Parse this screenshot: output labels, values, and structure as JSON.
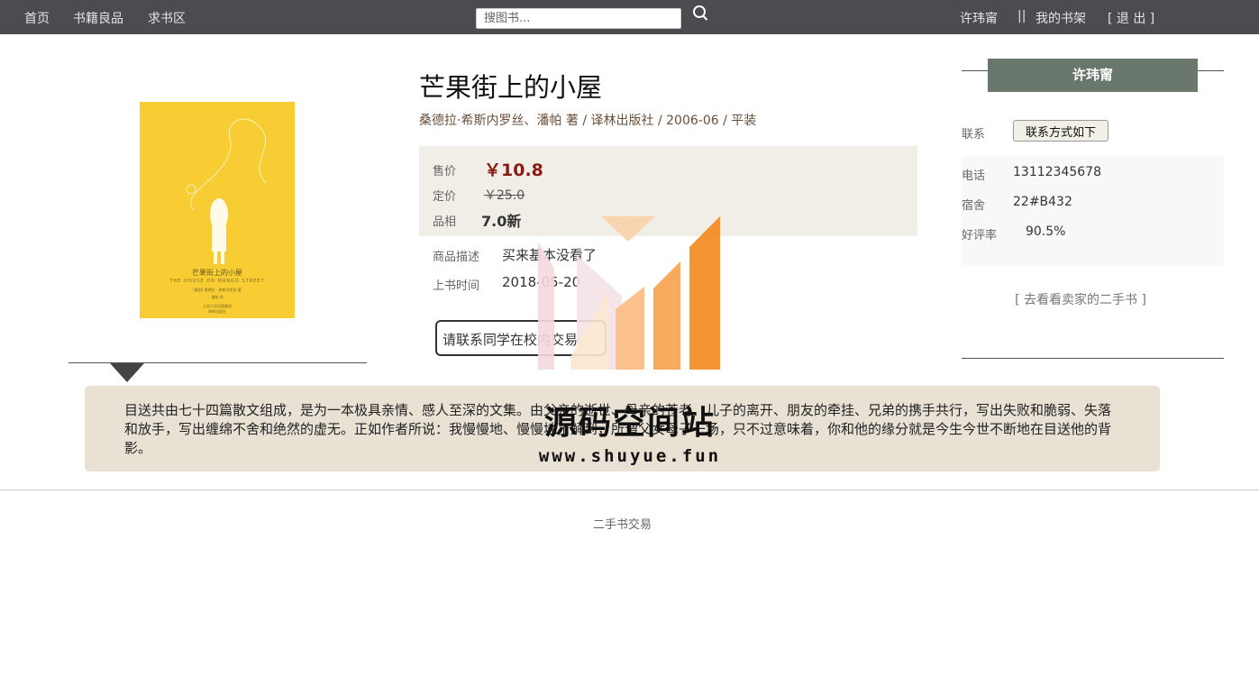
{
  "nav": {
    "home": "首页",
    "books": "书籍良品",
    "wanted": "求书区",
    "search_placeholder": "搜图书...",
    "username": "许玮甯",
    "separator": "||",
    "my_shelf": "我的书架",
    "logout": "[ 退 出 ]"
  },
  "cover": {
    "title": "芒果街上的小屋",
    "subtitle": "THE HOUSE ON MANGO STREET",
    "author_line": "[美国] 桑德拉 · 希斯内罗丝 著",
    "translator_line": "潘帕 译",
    "publisher_line": "江苏人民出版集团",
    "publisher_line2": "译林出版社",
    "background_color": "#f7cd33"
  },
  "book": {
    "title": "芒果街上的小屋",
    "meta": "桑德拉·希斯内罗丝、潘帕 著 / 译林出版社 / 2006-06 / 平装",
    "sale_label": "售价",
    "sale_price": "￥10.8",
    "list_label": "定价",
    "list_price": "￥25.0",
    "condition_label": "品相",
    "condition": "7.0新",
    "desc_label": "商品描述",
    "desc_value": "买来基本没看了",
    "listed_label": "上书时间",
    "listed_value": "2018-05-20",
    "contact_tip": "请联系同学在校内交易"
  },
  "seller": {
    "name": "许玮甯",
    "contact_label": "联系",
    "contact_button": "联系方式如下",
    "phone_label": "电话",
    "phone": "13112345678",
    "dorm_label": "宿舍",
    "dorm": "22#B432",
    "rating_label": "好评率",
    "rating": "90.5%",
    "more_books": "[ 去看看卖家的二手书 ]"
  },
  "description": "目送共由七十四篇散文组成，是为一本极具亲情、感人至深的文集。由父亲的逝世、母亲的苍老、儿子的离开、朋友的牵挂、兄弟的携手共行，写出失败和脆弱、失落和放手，写出缠绵不舍和绝然的虚无。正如作者所说：我慢慢地、慢慢地了解到，所谓父女母子一场，只不过意味着，你和他的缘分就是今生今世不断地在目送他的背影。",
  "footer": "二手书交易",
  "watermark": {
    "title": "源码空间站",
    "url": "www.shuyue.fun"
  },
  "colors": {
    "nav_bg": "#4b4b50",
    "price_red": "#8a1a14",
    "seller_header": "#6a776d",
    "price_box_bg": "#f1eee7",
    "desc_bg": "#e8e1d4",
    "watermark_orange": "#f5891c"
  }
}
